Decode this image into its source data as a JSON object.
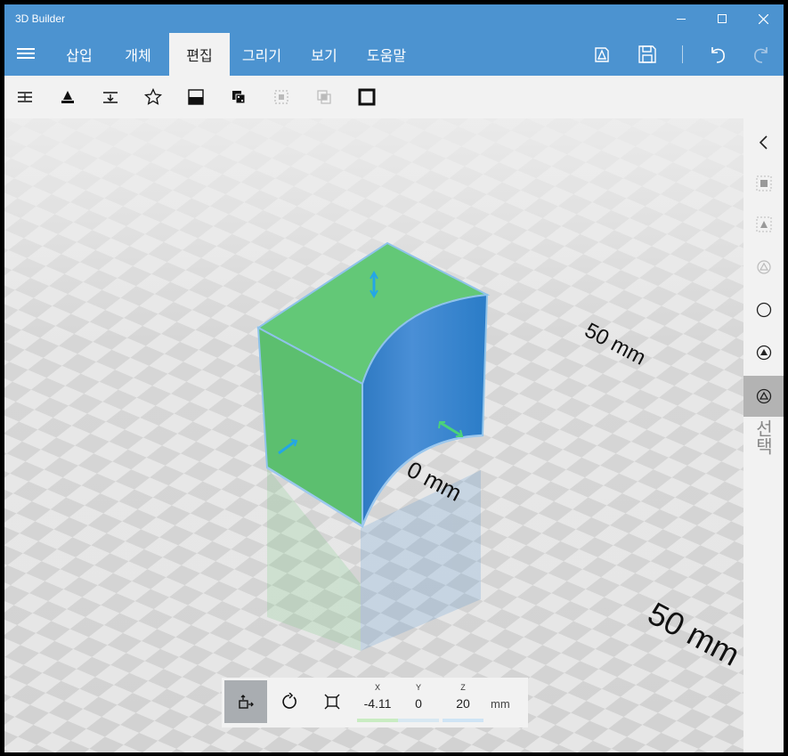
{
  "app": {
    "title": "3D Builder"
  },
  "window_controls": [
    "minimize-icon",
    "maximize-icon",
    "close-icon"
  ],
  "menu": {
    "tabs": [
      {
        "label": "삽입",
        "active": false
      },
      {
        "label": "개체",
        "active": false
      },
      {
        "label": "편집",
        "active": true
      },
      {
        "label": "그리기",
        "active": false
      },
      {
        "label": "보기",
        "active": false
      },
      {
        "label": "도움말",
        "active": false
      }
    ],
    "right_icons": [
      "export-3d-icon",
      "save-icon",
      "undo-icon",
      "redo-icon"
    ]
  },
  "ribbon": {
    "tools": [
      "split-icon",
      "simplify-icon",
      "extrude-icon",
      "emboss-icon",
      "smooth-icon",
      "merge-icon",
      "subtract-icon",
      "intersect-icon",
      "hollow-icon"
    ]
  },
  "viewport": {
    "labels": {
      "near": "0 mm",
      "right": "50 mm",
      "bottom": "50 mm"
    },
    "object_colors": {
      "box": "#5cc36b",
      "cut_face": "#3a86cf"
    }
  },
  "right_panel": {
    "buttons": [
      "collapse-panel-icon",
      "select-objects-icon",
      "select-faces-icon",
      "select-lasso-icon",
      "select-circle-icon",
      "select-triangle-icon",
      "select-mode-triangle-icon"
    ],
    "label": "선택"
  },
  "transform": {
    "tools": [
      "move-icon",
      "rotate-icon",
      "scale-icon"
    ],
    "x": {
      "label": "X",
      "value": "-4.11"
    },
    "y": {
      "label": "Y",
      "value": "0"
    },
    "z": {
      "label": "Z",
      "value": "20"
    },
    "unit": "mm"
  },
  "colors": {
    "accent": "#4c93d0",
    "panel": "#f2f2f2"
  }
}
